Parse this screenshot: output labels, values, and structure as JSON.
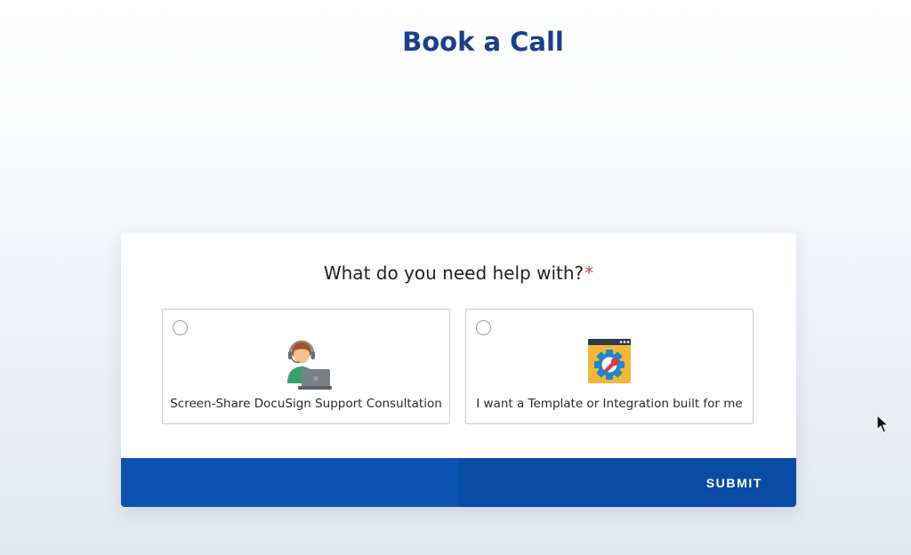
{
  "page": {
    "title": "Book a Call"
  },
  "form": {
    "question": "What do you need help with?",
    "required_mark": "*",
    "options": [
      {
        "label": "Screen-Share DocuSign Support Consultation",
        "icon": "support-agent-icon",
        "selected": false
      },
      {
        "label": "I want a Template or Integration built for me",
        "icon": "gear-wrench-icon",
        "selected": false
      }
    ],
    "submit_label": "SUBMIT"
  },
  "colors": {
    "title": "#1c3f8a",
    "submit_bar": "#0a4ba6",
    "required": "#d93b30"
  }
}
